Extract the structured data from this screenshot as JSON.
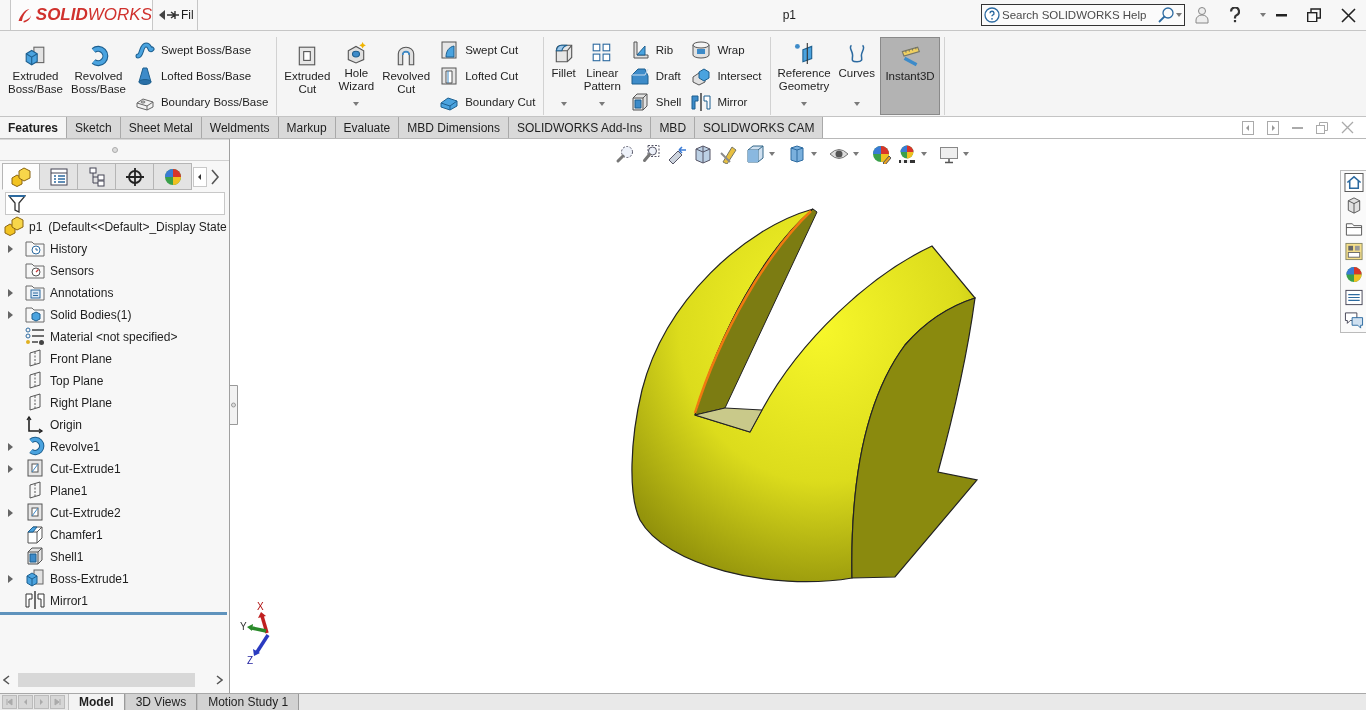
{
  "title_bar": {
    "logo": "**SOLID**WORKS",
    "menu": "Fil",
    "document_title": "p1",
    "search": {
      "placeholder": "Search SOLIDWORKS Help"
    }
  },
  "ribbon": {
    "groups": [
      {
        "columns": [
          {
            "kind": "large",
            "label": "Extruded Boss/Base",
            "dropdown": false,
            "pressed": false
          },
          {
            "kind": "large",
            "label": "Revolved Boss/Base",
            "dropdown": false,
            "pressed": false
          },
          {
            "kind": "stack",
            "buttons": [
              "Swept Boss/Base",
              "Lofted Boss/Base",
              "Boundary Boss/Base"
            ]
          }
        ]
      },
      {
        "columns": [
          {
            "kind": "large",
            "label": "Extruded Cut",
            "dropdown": false,
            "pressed": false
          },
          {
            "kind": "large",
            "label": "Hole Wizard",
            "dropdown": true,
            "pressed": false
          },
          {
            "kind": "large",
            "label": "Revolved Cut",
            "dropdown": false,
            "pressed": false
          },
          {
            "kind": "stack",
            "buttons": [
              "Swept Cut",
              "Lofted Cut",
              "Boundary Cut"
            ]
          }
        ]
      },
      {
        "columns": [
          {
            "kind": "large",
            "label": "Fillet",
            "dropdown": true,
            "pressed": false
          },
          {
            "kind": "large",
            "label": "Linear Pattern",
            "dropdown": true,
            "pressed": false
          },
          {
            "kind": "stack",
            "buttons": [
              "Rib",
              "Draft",
              "Shell"
            ]
          },
          {
            "kind": "stack",
            "buttons": [
              "Wrap",
              "Intersect",
              "Mirror"
            ]
          }
        ]
      },
      {
        "columns": [
          {
            "kind": "large",
            "label": "Reference Geometry",
            "dropdown": true,
            "pressed": false
          },
          {
            "kind": "large",
            "label": "Curves",
            "dropdown": true,
            "pressed": false
          },
          {
            "kind": "large",
            "label": "Instant3D",
            "dropdown": false,
            "pressed": true
          }
        ]
      }
    ]
  },
  "command_tabs": [
    {
      "label": "Features",
      "selected": true
    },
    {
      "label": "Sketch",
      "selected": false
    },
    {
      "label": "Sheet Metal",
      "selected": false
    },
    {
      "label": "Weldments",
      "selected": false
    },
    {
      "label": "Markup",
      "selected": false
    },
    {
      "label": "Evaluate",
      "selected": false
    },
    {
      "label": "MBD Dimensions",
      "selected": false
    },
    {
      "label": "SOLIDWORKS Add-Ins",
      "selected": false
    },
    {
      "label": "MBD",
      "selected": false
    },
    {
      "label": "SOLIDWORKS CAM",
      "selected": false
    }
  ],
  "feature_manager": {
    "panel_tabs": [
      {
        "selected": true
      },
      {
        "selected": false
      },
      {
        "selected": false
      },
      {
        "selected": false
      },
      {
        "selected": false
      }
    ],
    "tree": {
      "name": "p1",
      "configuration": "(Default<<Default>_Display State",
      "children": [
        {
          "label": "History",
          "kind": "history",
          "expandable": true
        },
        {
          "label": "Sensors",
          "kind": "sensors",
          "expandable": false
        },
        {
          "label": "Annotations",
          "kind": "annotations",
          "expandable": true
        },
        {
          "label": "Solid Bodies(1)",
          "kind": "bodies",
          "expandable": true
        },
        {
          "label": "Material <not specified>",
          "kind": "material",
          "expandable": false
        },
        {
          "label": "Front Plane",
          "kind": "plane",
          "expandable": false
        },
        {
          "label": "Top Plane",
          "kind": "plane",
          "expandable": false
        },
        {
          "label": "Right Plane",
          "kind": "plane",
          "expandable": false
        },
        {
          "label": "Origin",
          "kind": "origin",
          "expandable": false
        },
        {
          "label": "Revolve1",
          "kind": "revolve",
          "expandable": true
        },
        {
          "label": "Cut-Extrude1",
          "kind": "cut-extrude",
          "expandable": true
        },
        {
          "label": "Plane1",
          "kind": "plane",
          "expandable": false
        },
        {
          "label": "Cut-Extrude2",
          "kind": "cut-extrude",
          "expandable": true
        },
        {
          "label": "Chamfer1",
          "kind": "chamfer",
          "expandable": false
        },
        {
          "label": "Shell1",
          "kind": "shell",
          "expandable": false
        },
        {
          "label": "Boss-Extrude1",
          "kind": "boss-extrude",
          "expandable": true
        },
        {
          "label": "Mirror1",
          "kind": "mirror",
          "expandable": false
        }
      ]
    }
  },
  "viewport": {
    "triad": {
      "axes": [
        "X",
        "Y",
        "Z"
      ]
    }
  },
  "bottom_tabs": [
    {
      "label": "Model",
      "selected": true
    },
    {
      "label": "3D Views",
      "selected": false
    },
    {
      "label": "Motion Study 1",
      "selected": false
    }
  ]
}
